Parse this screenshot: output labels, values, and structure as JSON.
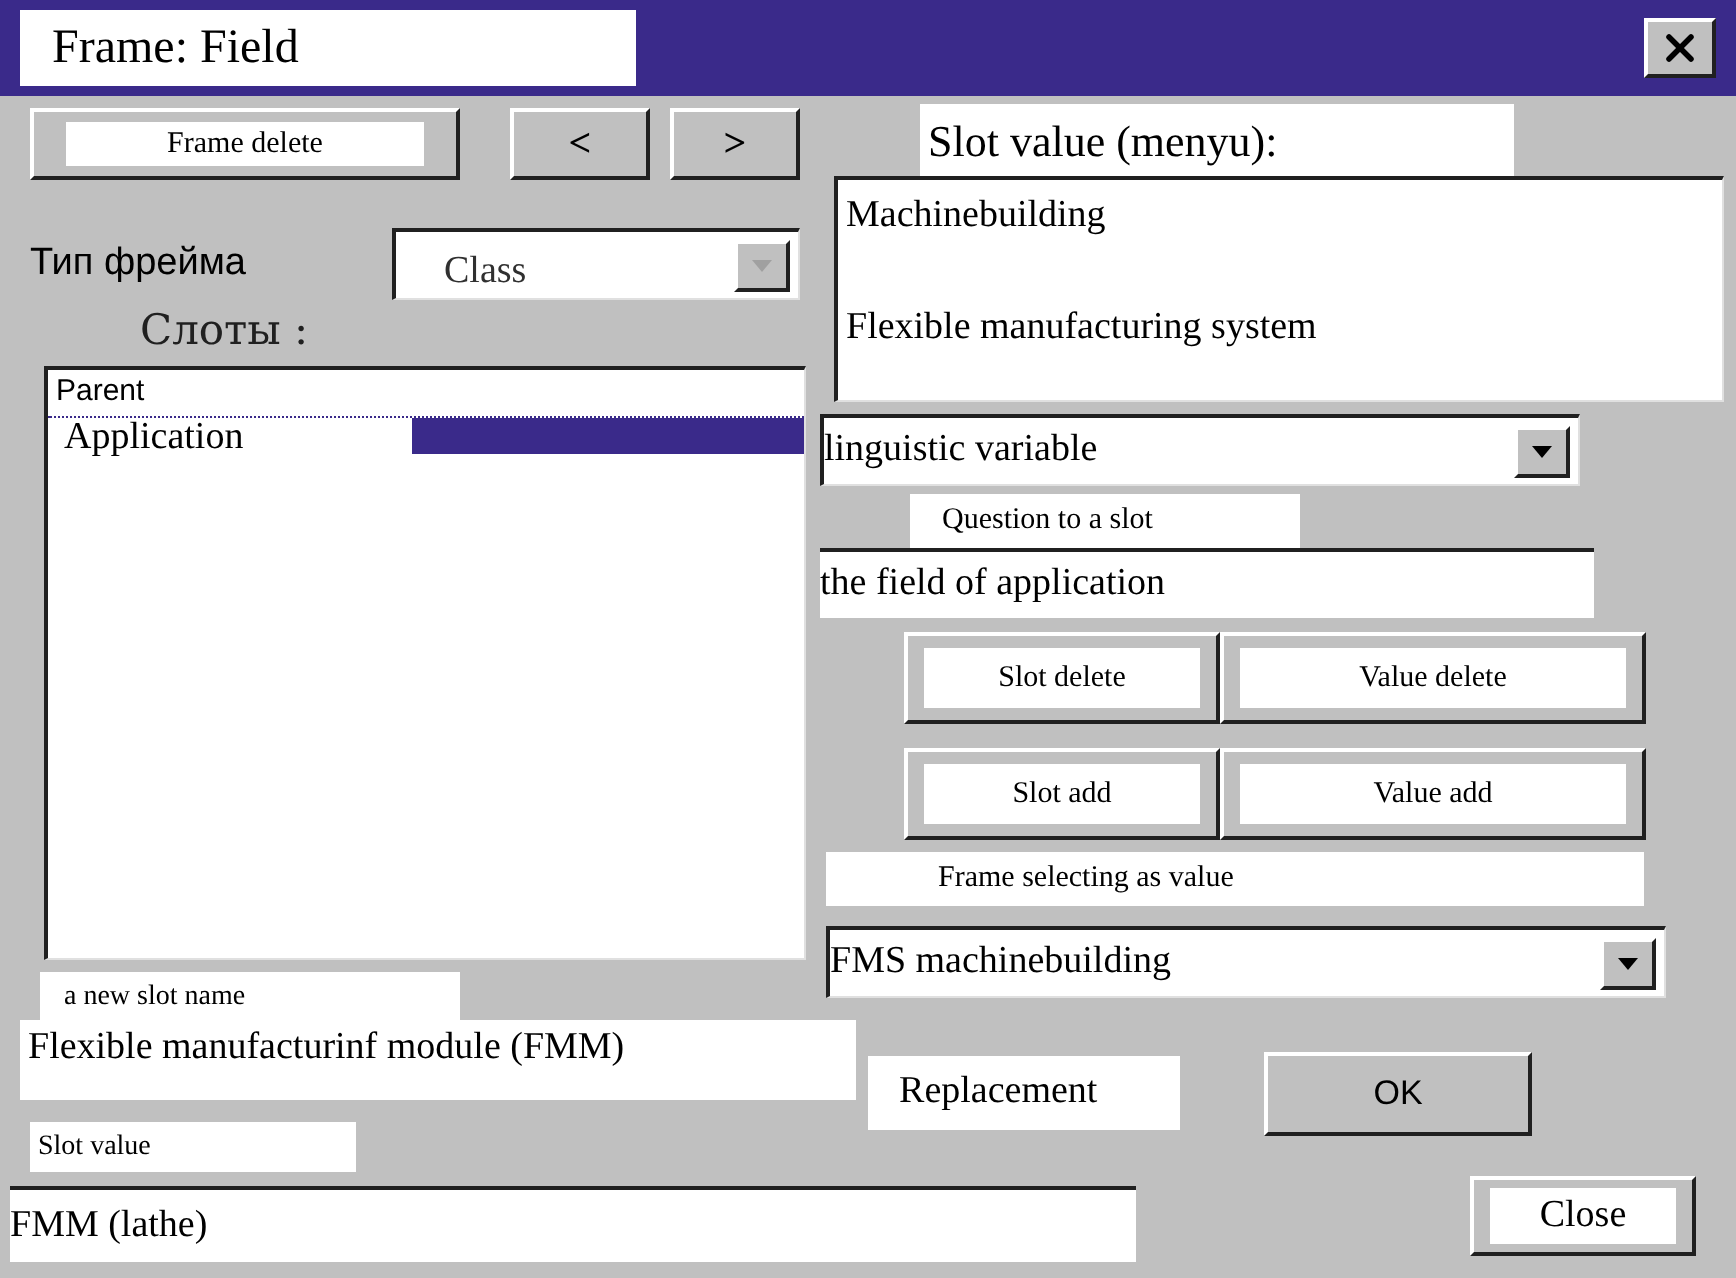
{
  "window": {
    "title": "Frame: Field"
  },
  "toolbar": {
    "delete_button": "Frame delete",
    "prev_button": "<",
    "next_button": ">"
  },
  "frame_type": {
    "label": "Тип фрейма",
    "value": "Class",
    "disabled": true
  },
  "slots": {
    "label": "Слоты :",
    "items": [
      {
        "label": "Parent",
        "selected": false
      },
      {
        "label": "Application",
        "selected": true
      }
    ]
  },
  "new_slot_name": {
    "label": "a new slot name",
    "value": "Flexible manufacturinf module (FMM)"
  },
  "slot_value": {
    "label": "Slot value",
    "value": "FMM (lathe)"
  },
  "slot_value_menu": {
    "label": "Slot value (menyu):",
    "items": [
      "Machinebuilding",
      "Flexible manufacturing system"
    ]
  },
  "value_type": {
    "value": "linguistic variable",
    "disabled": false
  },
  "question": {
    "label": "Question to a slot",
    "value": "the field of application"
  },
  "slot_buttons": [
    {
      "label": "Slot delete"
    },
    {
      "label": "Value delete"
    }
  ],
  "add_buttons": [
    {
      "label": "Slot add"
    },
    {
      "label": "Value add"
    }
  ],
  "frame_selection": {
    "label": "Frame selecting as value",
    "value": "FMS machinebuilding",
    "disabled": false
  },
  "replacement": "Replacement",
  "ok_button": "OK",
  "close_button": "Close"
}
